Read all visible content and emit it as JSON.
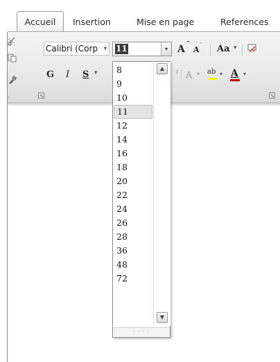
{
  "tabs": [
    "Accueil",
    "Insertion",
    "Mise en page",
    "References"
  ],
  "active_tab": "Accueil",
  "font": {
    "name": "Calibri (Corp",
    "size": "11"
  },
  "format_buttons": {
    "bold": "G",
    "italic": "I",
    "underline": "S",
    "grow_font": "A",
    "shrink_font": "A",
    "change_case": "Aa",
    "highlight": "ab",
    "font_color": "A"
  },
  "size_options": [
    "8",
    "9",
    "10",
    "11",
    "12",
    "14",
    "16",
    "18",
    "20",
    "22",
    "24",
    "26",
    "28",
    "36",
    "48",
    "72"
  ],
  "selected_size": "11",
  "colors": {
    "font_color_bar": "#c00000",
    "highlight_bar": "#ffff00",
    "selection_fill": "#3a3a3a"
  }
}
